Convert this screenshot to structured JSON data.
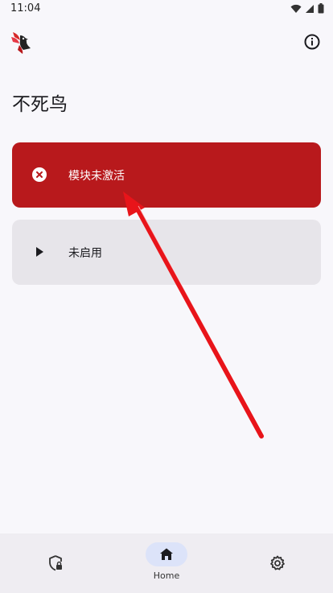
{
  "status_bar": {
    "time": "11:04"
  },
  "header": {
    "title": "不死鸟"
  },
  "cards": {
    "module_status": {
      "label": "模块未激活"
    },
    "launch": {
      "label": "未启用"
    }
  },
  "bottom_nav": {
    "home_label": "Home"
  },
  "colors": {
    "error_card": "#b8191c",
    "neutral_card": "#e7e5ea",
    "nav_indicator": "#dce3f9",
    "annotation_arrow": "#e8141a"
  }
}
